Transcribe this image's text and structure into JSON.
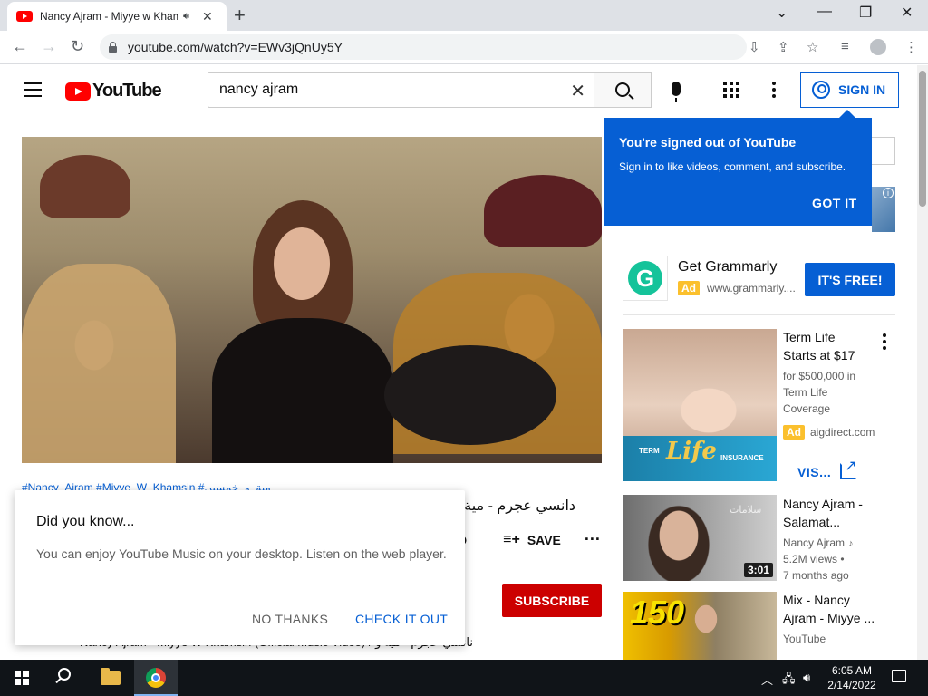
{
  "browser": {
    "tab_title": "Nancy Ajram - Miyye w Khamsin",
    "url": "youtube.com/watch?v=EWv3jQnUy5Y",
    "new_tab": "+",
    "win_minimize": "—",
    "win_restore": "❐",
    "win_close": "✕",
    "tab_close": "✕",
    "chevron": "⌄"
  },
  "header": {
    "logo_text": "YouTube",
    "search_value": "nancy ajram",
    "sign_in": "SIGN IN"
  },
  "tooltip": {
    "title": "You're signed out of YouTube",
    "body": "Sign in to like videos, comment, and subscribe.",
    "button": "GOT IT"
  },
  "video": {
    "hashtags": "#Nancy_Ajram #Miyye_W_Khamsin #مية_و_خمسين",
    "title": "دانسي عجرم - مية و",
    "download_tail": "D",
    "save": "SAVE",
    "more": "···",
    "subscribe": "SUBSCRIBE",
    "description": "Nancy Ajram - Miyye W Khamsin (Official Music Video) / نانسي عجرم - مية و"
  },
  "dialog": {
    "title": "Did you know...",
    "body": "You can enjoy YouTube Music on your desktop. Listen on the web player.",
    "no_thanks": "NO THANKS",
    "check_it_out": "CHECK IT OUT"
  },
  "ads": {
    "grammarly": {
      "title": "Get Grammarly",
      "badge": "Ad",
      "domain": "www.grammarly....",
      "cta": "IT'S FREE!"
    },
    "termlife": {
      "title": "Term Life Starts at $17",
      "subtitle": "for $500,000 in Term Life Coverage",
      "badge": "Ad",
      "domain": "aigdirect.com",
      "visit": "VIS...",
      "img_term": "TERM",
      "img_life": "Life",
      "img_insurance": "INSURANCE"
    }
  },
  "related": [
    {
      "title": "Nancy Ajram - Salamat...",
      "channel": "Nancy Ajram",
      "views": "5.2M views •",
      "age": "7 months ago",
      "duration": "3:01",
      "thumb_text": "سلامات"
    },
    {
      "title": "Mix - Nancy Ajram - Miyye ...",
      "channel": "YouTube",
      "thumb_text": "150"
    }
  ],
  "taskbar": {
    "time": "6:05 AM",
    "date": "2/14/2022"
  },
  "colors": {
    "yt_red": "#ff0000",
    "yt_blue": "#065fd4",
    "subscribe_red": "#cc0000",
    "ad_yellow": "#fbc02d",
    "grammarly_green": "#15c39a"
  }
}
